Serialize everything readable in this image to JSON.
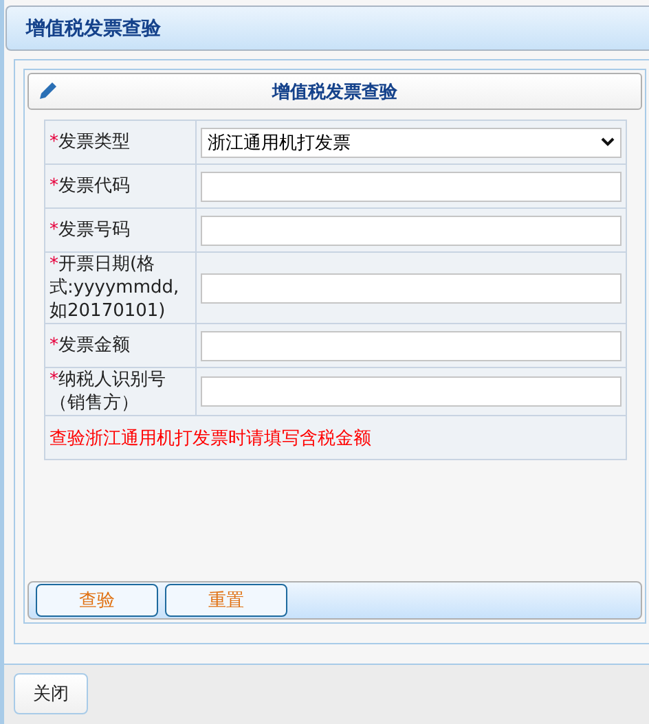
{
  "window": {
    "title": "增值税发票查验"
  },
  "panel": {
    "title": "增值税发票查验"
  },
  "fields": [
    {
      "kind": "select",
      "mark": "*",
      "label": "发票类型",
      "value": "浙江通用机打发票"
    },
    {
      "kind": "text",
      "mark": "*",
      "label": "发票代码"
    },
    {
      "kind": "text",
      "mark": "*",
      "label": "发票号码"
    },
    {
      "kind": "text",
      "mark": "*",
      "label": "开票日期(格式:yyyymmdd,如20170101)"
    },
    {
      "kind": "text",
      "mark": "*",
      "label": "发票金额"
    },
    {
      "kind": "text",
      "mark": "*",
      "label": "纳税人识别号（销售方）"
    }
  ],
  "note": "查验浙江通用机打发票时请填写含税金额",
  "actions": [
    "查验",
    "重置"
  ],
  "footer_buttons": [
    "关闭"
  ]
}
